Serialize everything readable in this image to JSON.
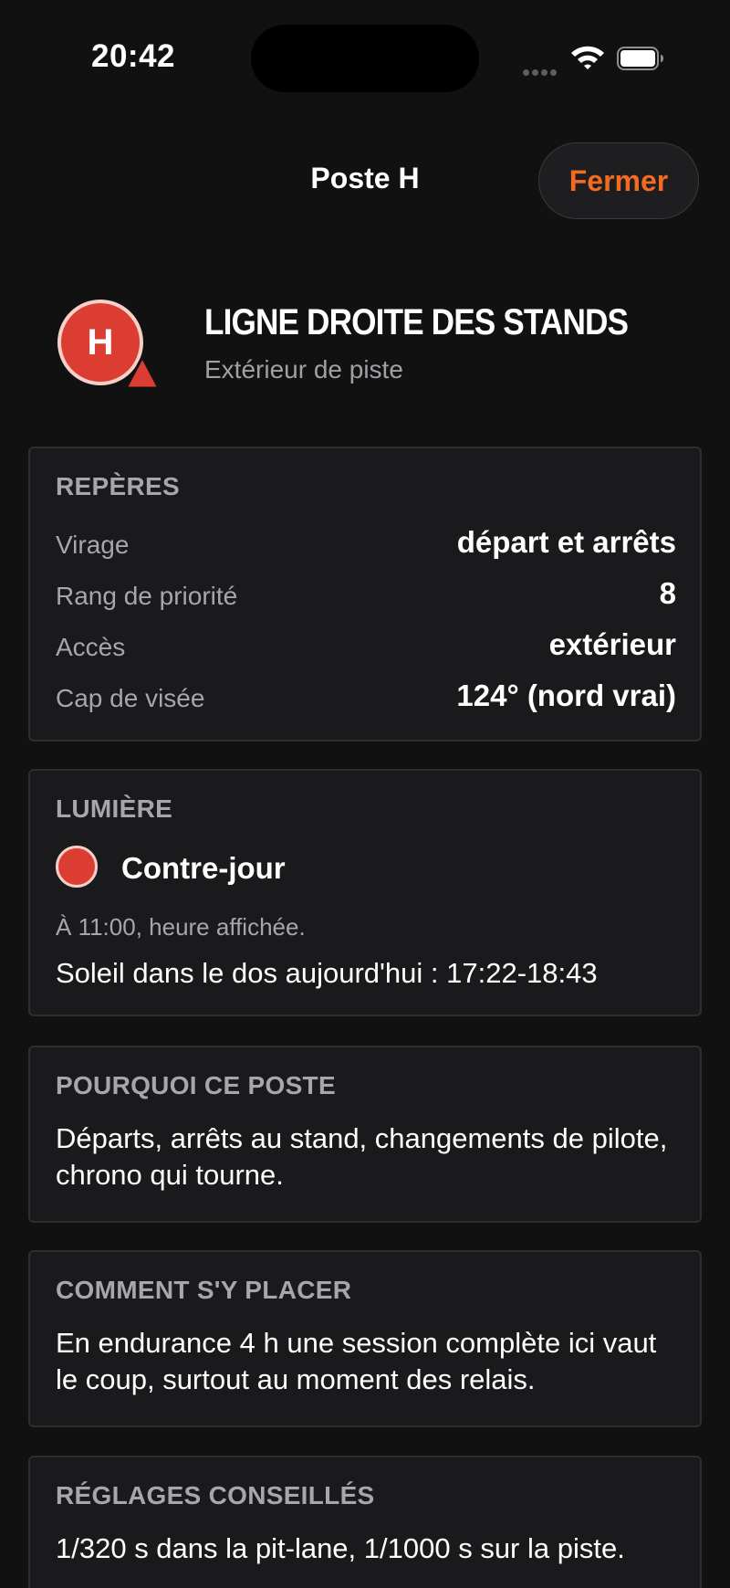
{
  "status_bar": {
    "time": "20:42"
  },
  "nav": {
    "title": "Poste H",
    "close_label": "Fermer"
  },
  "header": {
    "badge_letter": "H",
    "title": "LIGNE DROITE DES STANDS",
    "subtitle": "Extérieur de piste"
  },
  "reperes": {
    "title": "REPÈRES",
    "rows": [
      {
        "key": "Virage",
        "value": "départ et arrêts"
      },
      {
        "key": "Rang de priorité",
        "value": "8"
      },
      {
        "key": "Accès",
        "value": "extérieur"
      },
      {
        "key": "Cap de visée",
        "value": "124° (nord vrai)"
      }
    ]
  },
  "lumiere": {
    "title": "LUMIÈRE",
    "status": "Contre-jour",
    "status_color": "#dc3d33",
    "note": "À 11:00, heure affichée.",
    "sun_window": "Soleil dans le dos aujourd'hui : 17:22-18:43"
  },
  "pourquoi": {
    "title": "POURQUOI CE POSTE",
    "text": "Départs, arrêts au stand, changements de pilote, chrono qui tourne."
  },
  "placement": {
    "title": "COMMENT S'Y PLACER",
    "text": "En endurance 4 h une session complète ici vaut le coup, surtout au moment des relais."
  },
  "reglages": {
    "title": "RÉGLAGES CONSEILLÉS",
    "text": "1/320 s dans la pit-lane, 1/1000 s sur la piste."
  },
  "colors": {
    "accent": "#f26b22",
    "badge": "#dc3d33",
    "background": "#111112",
    "card": "#1a1a1c"
  },
  "icons": [
    "cellular-signal-icon",
    "wifi-icon",
    "battery-icon",
    "poste-marker-icon"
  ]
}
